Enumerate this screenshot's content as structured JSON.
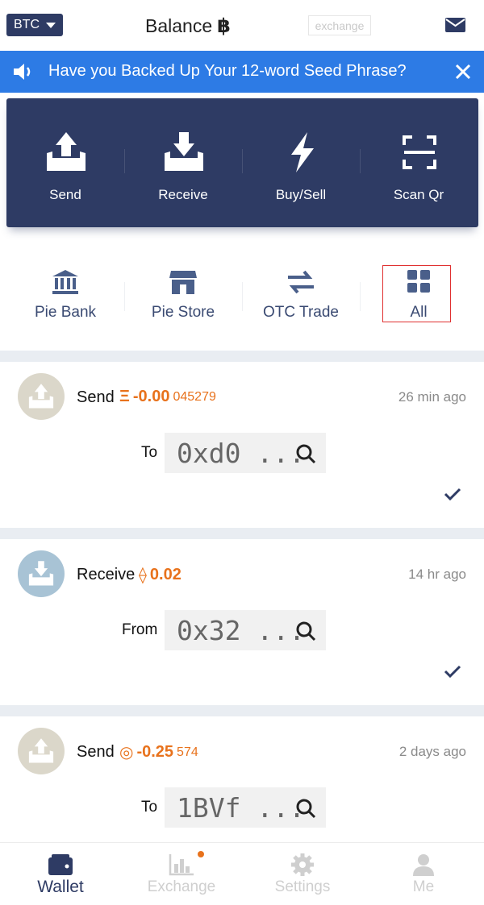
{
  "header": {
    "currency": "BTC",
    "title": "Balance",
    "title_symbol": "฿",
    "exchange_tag": "exchange"
  },
  "banner": {
    "text": "Have you Backed Up Your 12-word Seed Phrase?"
  },
  "actions": [
    {
      "label": "Send",
      "icon": "send-tray-icon"
    },
    {
      "label": "Receive",
      "icon": "receive-tray-icon"
    },
    {
      "label": "Buy/Sell",
      "icon": "lightning-icon"
    },
    {
      "label": "Scan Qr",
      "icon": "scan-qr-icon"
    }
  ],
  "subnav": [
    {
      "label": "Pie Bank",
      "icon": "bank-icon"
    },
    {
      "label": "Pie Store",
      "icon": "store-icon"
    },
    {
      "label": "OTC Trade",
      "icon": "swap-arrows-icon"
    },
    {
      "label": "All",
      "icon": "grid-icon"
    }
  ],
  "transactions": [
    {
      "kind": "Send",
      "coin_symbol": "Ξ",
      "amount_main": "-0.00",
      "amount_tail": "045279",
      "time": "26 min ago",
      "direction": "To",
      "address": "0xd0 ...",
      "status": "confirmed"
    },
    {
      "kind": "Receive",
      "coin_symbol": "⟠",
      "amount_main": "0.02",
      "amount_tail": "",
      "time": "14 hr ago",
      "direction": "From",
      "address": "0x32 ...",
      "status": "confirmed"
    },
    {
      "kind": "Send",
      "coin_symbol": "◎",
      "amount_main": "-0.25",
      "amount_tail": "574",
      "time": "2 days ago",
      "direction": "To",
      "address": "1BVf ...",
      "status": ""
    }
  ],
  "bottom_nav": [
    {
      "label": "Wallet",
      "icon": "wallet-icon",
      "active": true
    },
    {
      "label": "Exchange",
      "icon": "chart-icon",
      "active": false,
      "notification": true
    },
    {
      "label": "Settings",
      "icon": "gear-icon",
      "active": false
    },
    {
      "label": "Me",
      "icon": "user-icon",
      "active": false
    }
  ],
  "colors": {
    "navy": "#2e3b64",
    "banner_blue": "#2d7be5",
    "accent_orange": "#e8721c",
    "highlight_red": "#e03131"
  }
}
